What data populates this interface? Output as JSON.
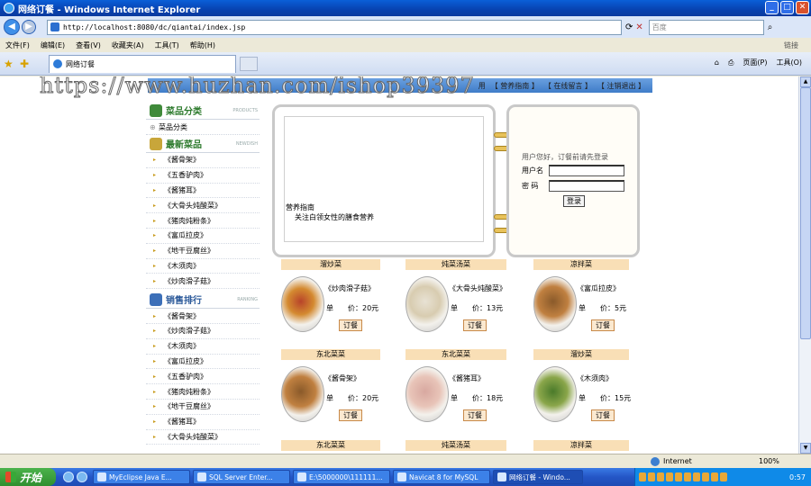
{
  "window": {
    "title": "网络订餐 - Windows Internet Explorer",
    "min": "_",
    "max": "□",
    "close": "✕"
  },
  "address": {
    "url": "http://localhost:8080/dc/qiantai/index.jsp",
    "search_placeholder": "百度"
  },
  "menu": {
    "items": [
      "文件(F)",
      "编辑(E)",
      "查看(V)",
      "收藏夹(A)",
      "工具(T)",
      "帮助(H)"
    ],
    "links_label": "链接"
  },
  "tab": {
    "title": "网络订餐"
  },
  "commands": {
    "page": "页面(P)",
    "tools": "工具(O)"
  },
  "watermark": "https://www.huzhan.com/ishop39397",
  "site_nav": [
    "用",
    "【 营养指南 】",
    "【 在线留言 】",
    "【 注销退出 】"
  ],
  "sidebar": {
    "category_head": "菜品分类",
    "category_en": "PRODUCTS",
    "category_item": "菜品分类",
    "new_head": "最新菜品",
    "new_en": "NEWDISH",
    "new_items": [
      "《酱骨架》",
      "《五香驴肉》",
      "《酱猪耳》",
      "《大骨头炖酸菜》",
      "《猪肉炖粉条》",
      "《富瓜拉皮》",
      "《地干豆腐丝》",
      "《木须肉》",
      "《炒肉滑子菇》"
    ],
    "rank_head": "销售排行",
    "rank_en": "RANKING",
    "rank_items": [
      "《酱骨架》",
      "《炒肉滑子菇》",
      "《木须肉》",
      "《富瓜拉皮》",
      "《五香驴肉》",
      "《猪肉炖粉条》",
      "《地干豆腐丝》",
      "《酱猪耳》",
      "《大骨头炖酸菜》"
    ]
  },
  "guide": {
    "title": "营养指南",
    "text": "关注白领女性的膳食营养"
  },
  "login": {
    "hint": "用户您好，订餐前请先登录",
    "username_label": "用户名",
    "password_label": "密 码",
    "button": "登录"
  },
  "row_headers": [
    [
      "溜炒菜",
      "炖菜汤菜",
      "凉拌菜"
    ],
    [
      "东北菜菜",
      "东北菜菜",
      "溜炒菜"
    ],
    [
      "东北菜菜",
      "炖菜汤菜",
      "凉拌菜"
    ]
  ],
  "dishes": [
    {
      "name": "《炒肉滑子菇》",
      "price_label": "单　　价：20元",
      "order": "订餐",
      "plate": "red"
    },
    {
      "name": "《大骨头炖酸菜》",
      "price_label": "单　　价：13元",
      "order": "订餐",
      "plate": "white"
    },
    {
      "name": "《富瓜拉皮》",
      "price_label": "单　　价：5元",
      "order": "订餐",
      "plate": "brown"
    },
    {
      "name": "《酱骨架》",
      "price_label": "单　　价：20元",
      "order": "订餐",
      "plate": "brown"
    },
    {
      "name": "《酱猪耳》",
      "price_label": "单　　价：18元",
      "order": "订餐",
      "plate": "pink"
    },
    {
      "name": "《木须肉》",
      "price_label": "单　　价：15元",
      "order": "订餐",
      "plate": "green"
    }
  ],
  "status": {
    "zone": "Internet",
    "zoom": "100%"
  },
  "taskbar": {
    "start": "开始",
    "tasks": [
      "MyEclipse Java E...",
      "SQL Server Enter...",
      "E:\\5000000\\111111...",
      "Navicat 8 for MySQL",
      "网络订餐 - Windo..."
    ],
    "clock": "0:57"
  }
}
